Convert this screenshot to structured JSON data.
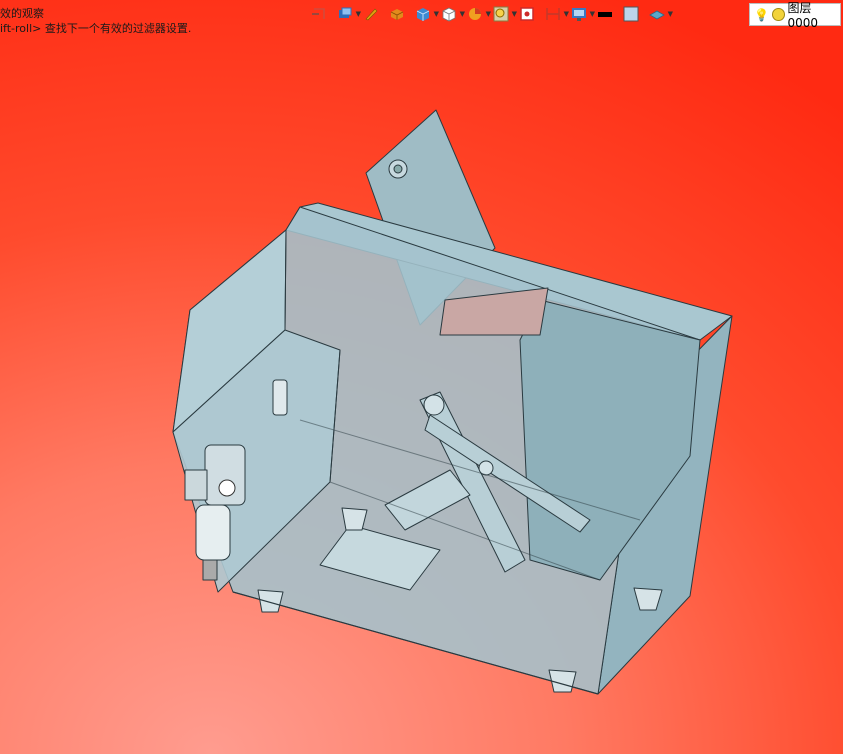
{
  "status": {
    "line1": "效的观察",
    "line2": "ift-roll> 查找下一个有效的过滤器设置."
  },
  "toolbar": {
    "items": [
      {
        "name": "snap-icon",
        "color": "#d24b3c"
      },
      {
        "name": "view-mode-icon",
        "color": "#2f6fb8"
      },
      {
        "name": "pen-icon",
        "color": "#e0a012"
      },
      {
        "name": "solid-box-icon",
        "color": "#e38a1c"
      },
      {
        "name": "cube-icon",
        "color": "#3b8ad1"
      },
      {
        "name": "wire-cube-icon",
        "color": "#9aa3ad"
      },
      {
        "name": "pie-icon",
        "color": "#f0a020"
      },
      {
        "name": "zoom-icon",
        "color": "#d59a13"
      },
      {
        "name": "face-icon",
        "color": "#cc2a2a"
      },
      {
        "name": "dimension-icon",
        "color": "#c0392b"
      },
      {
        "name": "display-icon",
        "color": "#3a78c2"
      },
      {
        "name": "line-color-icon",
        "color": "#000000"
      },
      {
        "name": "fill-color-icon",
        "color": "#bcd4ea"
      },
      {
        "name": "plane-icon",
        "color": "#5aa7c9"
      }
    ]
  },
  "layer": {
    "label": "图层0000"
  },
  "colors": {
    "bg_top": "#ff2a12",
    "bg_bottom": "#ff9c8f",
    "model": "#9fc2cc"
  }
}
